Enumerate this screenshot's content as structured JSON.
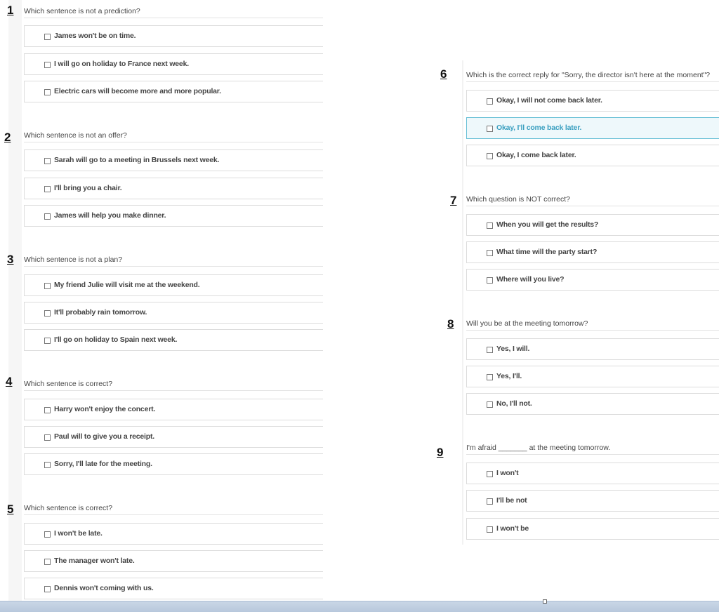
{
  "questions_left": [
    {
      "num": "1",
      "text": "Which sentence is not a prediction?",
      "options": [
        "James won't be on time.",
        "I will go on holiday to France next week.",
        "Electric cars will become more and more popular."
      ]
    },
    {
      "num": "2",
      "text": "Which sentence is not an offer?",
      "options": [
        "Sarah will go to a meeting in Brussels next week.",
        "I'll bring you a chair.",
        "James will help you make dinner."
      ]
    },
    {
      "num": "3",
      "text": "Which sentence is not a plan?",
      "options": [
        "My friend Julie will visit me at the weekend.",
        "It'll probably rain tomorrow.",
        "I'll go on holiday to Spain next week."
      ]
    },
    {
      "num": "4",
      "text": "Which sentence is correct?",
      "options": [
        "Harry won't enjoy the concert.",
        "Paul will to give you a receipt.",
        "Sorry, I'll late for the meeting."
      ]
    },
    {
      "num": "5",
      "text": "Which sentence is correct?",
      "options": [
        "I won't be late.",
        "The manager won't late.",
        "Dennis won't coming with us."
      ]
    }
  ],
  "questions_right": [
    {
      "num": "6",
      "text": "Which is the correct reply for \"Sorry, the director isn't here at the moment\"?",
      "options": [
        "Okay, I will not come back later.",
        "Okay, I'll come back later.",
        "Okay, I come back later."
      ],
      "selected": 1
    },
    {
      "num": "7",
      "text": "Which question is NOT correct?",
      "options": [
        "When you will get the results?",
        "What time will the party start?",
        "Where will you live?"
      ]
    },
    {
      "num": "8",
      "text": "Will you be at the meeting tomorrow?",
      "options": [
        "Yes, I will.",
        "Yes, I'll.",
        "No, I'll not."
      ]
    },
    {
      "num": "9",
      "text": "I'm afraid _______ at the meeting tomorrow.",
      "options": [
        "I won't",
        "I'll be not",
        "I won't be"
      ]
    }
  ],
  "colors": {
    "selected_border": "#69c0d6",
    "selected_text": "#3a9fc0"
  }
}
